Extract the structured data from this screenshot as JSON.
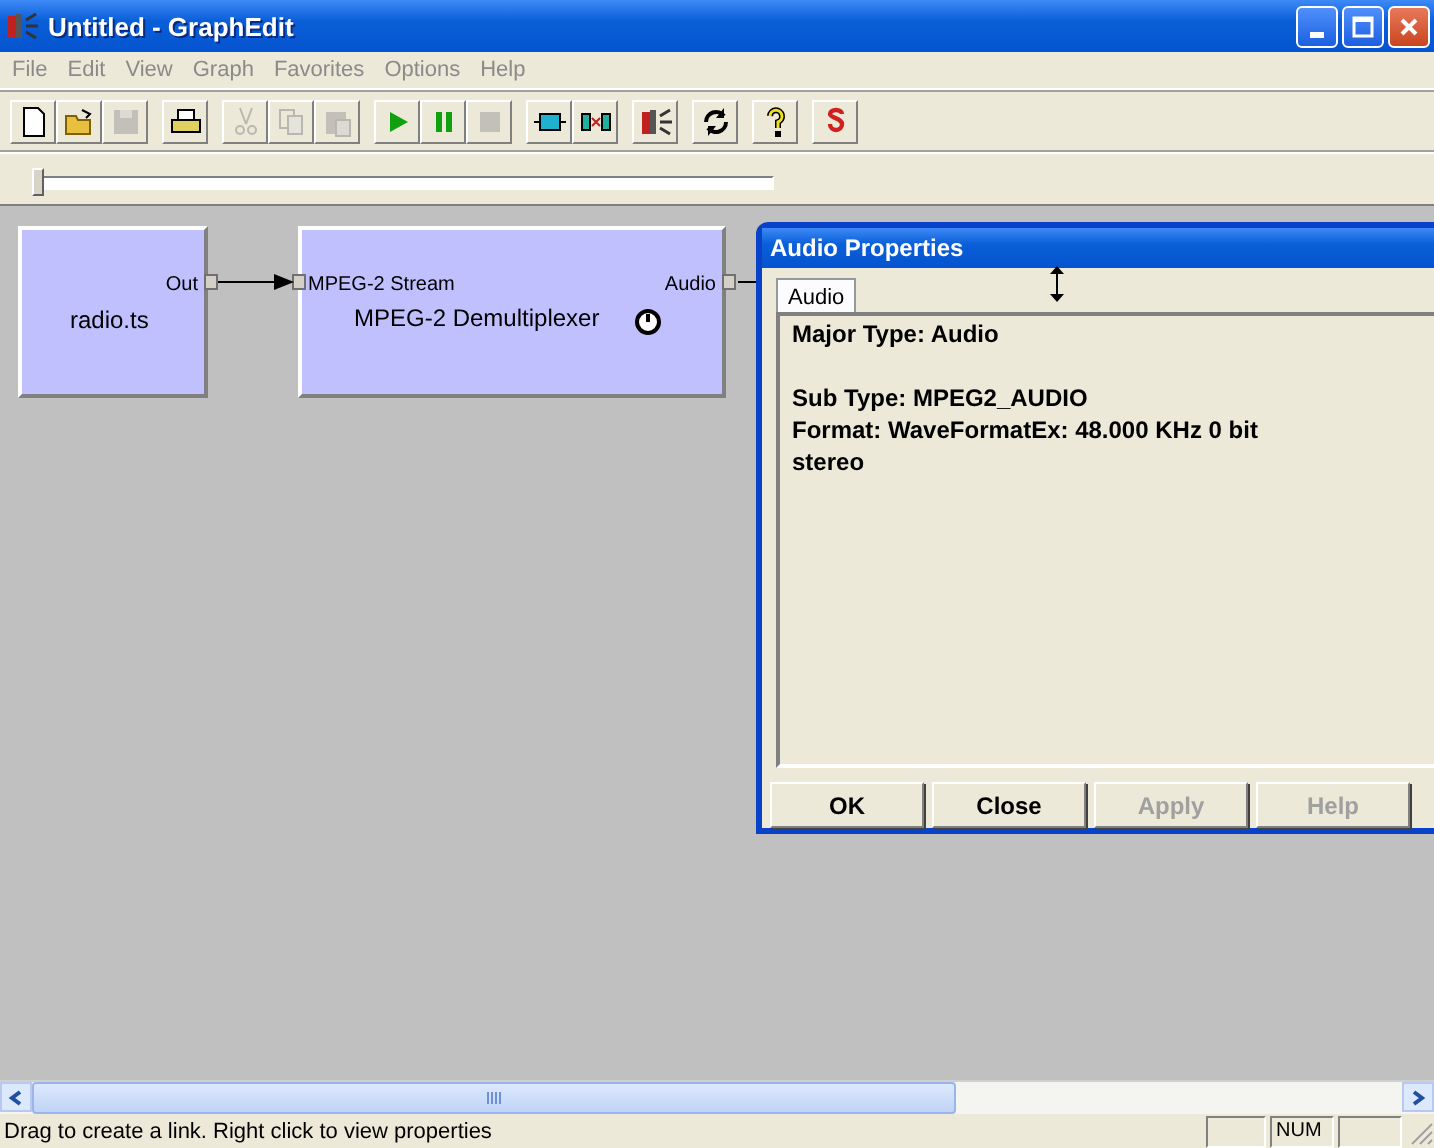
{
  "window": {
    "title": "Untitled - GraphEdit"
  },
  "menu": [
    "File",
    "Edit",
    "View",
    "Graph",
    "Favorites",
    "Options",
    "Help"
  ],
  "toolbar": [
    [
      {
        "kind": "new",
        "disabled": false
      },
      {
        "kind": "open",
        "disabled": false
      },
      {
        "kind": "save",
        "disabled": true
      }
    ],
    [
      {
        "kind": "print",
        "disabled": false
      }
    ],
    [
      {
        "kind": "cut",
        "disabled": true
      },
      {
        "kind": "copy",
        "disabled": true
      },
      {
        "kind": "paste",
        "disabled": true
      }
    ],
    [
      {
        "kind": "play",
        "disabled": false
      },
      {
        "kind": "pause",
        "disabled": false
      },
      {
        "kind": "stop",
        "disabled": true
      }
    ],
    [
      {
        "kind": "filter",
        "disabled": false
      },
      {
        "kind": "connect",
        "disabled": false
      }
    ],
    [
      {
        "kind": "app",
        "disabled": false
      }
    ],
    [
      {
        "kind": "refresh",
        "disabled": false
      }
    ],
    [
      {
        "kind": "help",
        "disabled": false
      }
    ],
    [
      {
        "kind": "s",
        "disabled": false
      }
    ]
  ],
  "seek": {
    "level": 0
  },
  "filters": [
    {
      "name": "radio.ts",
      "out_pin": "Out"
    },
    {
      "name": "MPEG-2 Demultiplexer",
      "in_pin": "MPEG-2 Stream",
      "out_pin": "Audio",
      "clock": true
    }
  ],
  "dialog": {
    "title": "Audio Properties",
    "tabs": [
      {
        "label": "Audio",
        "selected": true
      }
    ],
    "paragraphs": [
      [
        "Major Type:  Audio"
      ],
      [
        "Sub Type:  MPEG2_AUDIO",
        "Format:  WaveFormatEx: 48.000 KHz 0 bit",
        "stereo"
      ]
    ],
    "buttons": [
      {
        "label": "OK",
        "disabled": false
      },
      {
        "label": "Close",
        "disabled": false
      },
      {
        "label": "Apply",
        "disabled": true
      },
      {
        "label": "Help",
        "disabled": true
      }
    ]
  },
  "status_bar": {
    "text": "Drag to create a link. Right click to view properties",
    "panes": [
      {
        "kind": "blank"
      },
      {
        "kind": "text",
        "text": "NUM"
      },
      {
        "kind": "blank"
      }
    ]
  }
}
